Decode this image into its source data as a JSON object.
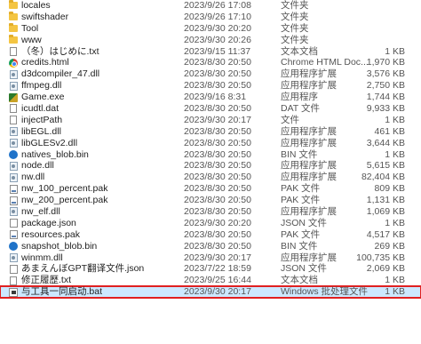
{
  "files": [
    {
      "icon": "folder-icon",
      "icon_class": "ico-folder",
      "name": "locales",
      "date": "2023/9/26 17:08",
      "type": "文件夹",
      "size": ""
    },
    {
      "icon": "folder-icon",
      "icon_class": "ico-folder",
      "name": "swiftshader",
      "date": "2023/9/26 17:10",
      "type": "文件夹",
      "size": ""
    },
    {
      "icon": "folder-icon",
      "icon_class": "ico-folder",
      "name": "Tool",
      "date": "2023/9/30 20:20",
      "type": "文件夹",
      "size": ""
    },
    {
      "icon": "folder-icon",
      "icon_class": "ico-folder",
      "name": "www",
      "date": "2023/9/30 20:26",
      "type": "文件夹",
      "size": ""
    },
    {
      "icon": "text-file-icon",
      "icon_class": "ico-doc",
      "name": "（冬）はじめに.txt",
      "date": "2023/9/15 11:37",
      "type": "文本文档",
      "size": "1 KB"
    },
    {
      "icon": "chrome-icon",
      "icon_class": "ico-chrome",
      "name": "credits.html",
      "date": "2023/8/30 20:50",
      "type": "Chrome HTML Doc...",
      "size": "1,970 KB"
    },
    {
      "icon": "dll-icon",
      "icon_class": "ico-dll",
      "name": "d3dcompiler_47.dll",
      "date": "2023/8/30 20:50",
      "type": "应用程序扩展",
      "size": "3,576 KB"
    },
    {
      "icon": "dll-icon",
      "icon_class": "ico-dll",
      "name": "ffmpeg.dll",
      "date": "2023/8/30 20:50",
      "type": "应用程序扩展",
      "size": "2,750 KB"
    },
    {
      "icon": "game-exe-icon",
      "icon_class": "ico-exe",
      "name": "Game.exe",
      "date": "2023/9/16 8:31",
      "type": "应用程序",
      "size": "1,744 KB"
    },
    {
      "icon": "data-file-icon",
      "icon_class": "ico-doc",
      "name": "icudtl.dat",
      "date": "2023/8/30 20:50",
      "type": "DAT 文件",
      "size": "9,933 KB"
    },
    {
      "icon": "file-icon",
      "icon_class": "ico-doc",
      "name": "injectPath",
      "date": "2023/9/30 20:17",
      "type": "文件",
      "size": "1 KB"
    },
    {
      "icon": "dll-icon",
      "icon_class": "ico-dll",
      "name": "libEGL.dll",
      "date": "2023/8/30 20:50",
      "type": "应用程序扩展",
      "size": "461 KB"
    },
    {
      "icon": "dll-icon",
      "icon_class": "ico-dll",
      "name": "libGLESv2.dll",
      "date": "2023/8/30 20:50",
      "type": "应用程序扩展",
      "size": "3,644 KB"
    },
    {
      "icon": "bin-file-icon",
      "icon_class": "ico-bin",
      "name": "natives_blob.bin",
      "date": "2023/8/30 20:50",
      "type": "BIN 文件",
      "size": "1 KB"
    },
    {
      "icon": "dll-icon",
      "icon_class": "ico-dll",
      "name": "node.dll",
      "date": "2023/8/30 20:50",
      "type": "应用程序扩展",
      "size": "5,615 KB"
    },
    {
      "icon": "dll-icon",
      "icon_class": "ico-dll",
      "name": "nw.dll",
      "date": "2023/8/30 20:50",
      "type": "应用程序扩展",
      "size": "82,404 KB"
    },
    {
      "icon": "pak-file-icon",
      "icon_class": "ico-pak",
      "name": "nw_100_percent.pak",
      "date": "2023/8/30 20:50",
      "type": "PAK 文件",
      "size": "809 KB"
    },
    {
      "icon": "pak-file-icon",
      "icon_class": "ico-pak",
      "name": "nw_200_percent.pak",
      "date": "2023/8/30 20:50",
      "type": "PAK 文件",
      "size": "1,131 KB"
    },
    {
      "icon": "dll-icon",
      "icon_class": "ico-dll",
      "name": "nw_elf.dll",
      "date": "2023/8/30 20:50",
      "type": "应用程序扩展",
      "size": "1,069 KB"
    },
    {
      "icon": "json-file-icon",
      "icon_class": "ico-json",
      "name": "package.json",
      "date": "2023/9/30 20:20",
      "type": "JSON 文件",
      "size": "1 KB"
    },
    {
      "icon": "pak-file-icon",
      "icon_class": "ico-pak",
      "name": "resources.pak",
      "date": "2023/8/30 20:50",
      "type": "PAK 文件",
      "size": "4,517 KB"
    },
    {
      "icon": "bin-file-icon",
      "icon_class": "ico-bin",
      "name": "snapshot_blob.bin",
      "date": "2023/8/30 20:50",
      "type": "BIN 文件",
      "size": "269 KB"
    },
    {
      "icon": "dll-icon",
      "icon_class": "ico-dll",
      "name": "winmm.dll",
      "date": "2023/9/30 20:17",
      "type": "应用程序扩展",
      "size": "100,735 KB"
    },
    {
      "icon": "json-file-icon",
      "icon_class": "ico-json",
      "name": "あまえんぼGPT翻译文件.json",
      "date": "2023/7/22 18:59",
      "type": "JSON 文件",
      "size": "2,069 KB"
    },
    {
      "icon": "text-file-icon",
      "icon_class": "ico-doc",
      "name": "修正履歴.txt",
      "date": "2023/9/25 16:44",
      "type": "文本文档",
      "size": "1 KB"
    },
    {
      "icon": "batch-file-icon",
      "icon_class": "ico-bat",
      "name": "与工具一同启动.bat",
      "date": "2023/9/30 20:17",
      "type": "Windows 批处理文件",
      "size": "1 KB",
      "selected": true
    }
  ],
  "colors": {
    "selection": "#cce8ff",
    "highlight_border": "#e02020",
    "folder": "#f4c542"
  }
}
